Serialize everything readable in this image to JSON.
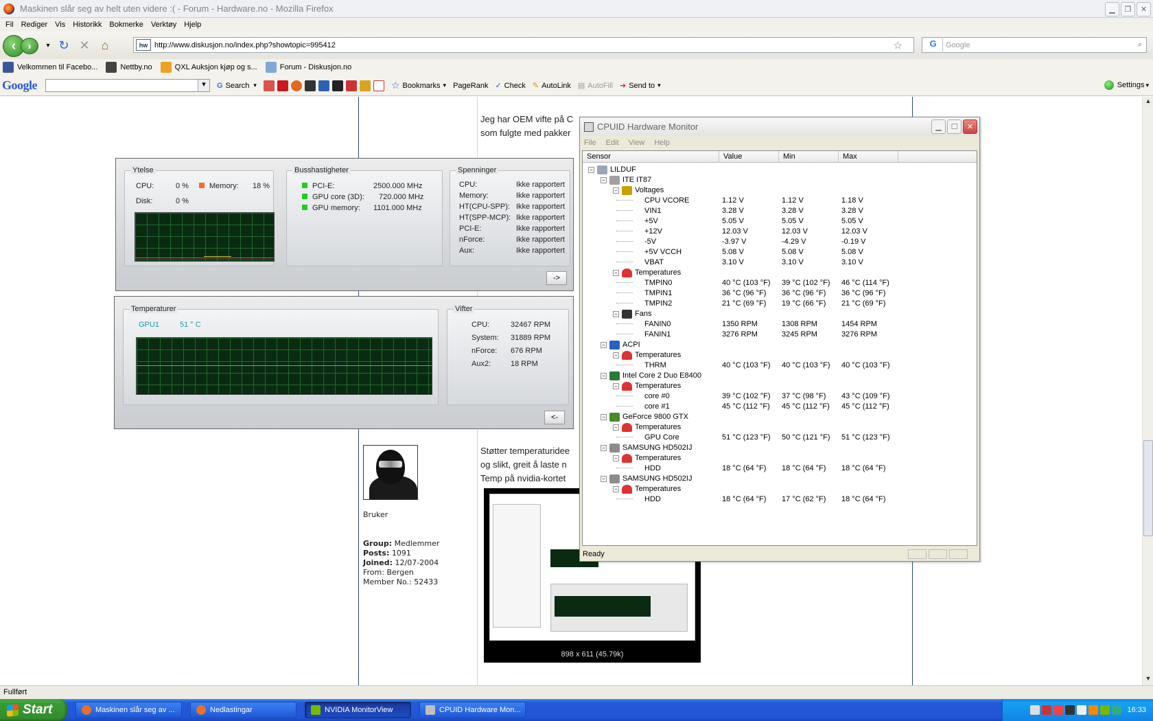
{
  "window": {
    "title": "Maskinen slår seg av helt uten videre :( - Forum - Hardware.no - Mozilla Firefox"
  },
  "menubar": [
    "Fil",
    "Rediger",
    "Vis",
    "Historikk",
    "Bokmerke",
    "Verktøy",
    "Hjelp"
  ],
  "navigation": {
    "url": "http://www.diskusjon.no/index.php?showtopic=995412",
    "favicon": "hw",
    "search_placeholder": "Google"
  },
  "bookmarks": [
    {
      "label": "Velkommen til Facebo...",
      "color": "#3b5998"
    },
    {
      "label": "Nettby.no",
      "color": "#444444"
    },
    {
      "label": "QXL Auksjon kjøp og s...",
      "color": "#f0a020"
    },
    {
      "label": "Forum - Diskusjon.no",
      "color": "#7fa8d8"
    }
  ],
  "googlebar": {
    "logo": "Google",
    "search_label": "Search",
    "bookmarks_label": "Bookmarks",
    "pagerank_label": "PageRank",
    "check_label": "Check",
    "autolink_label": "AutoLink",
    "autofill_label": "AutoFill",
    "sendto_label": "Send to",
    "settings_label": "Settings"
  },
  "forum": {
    "post_lines": [
      "Jeg har OEM vifte på C",
      "som fulgte med pakker"
    ],
    "post2_lines": [
      "Støtter temperaturidee",
      "og slikt, greit å laste n",
      "Temp på nvidia-kortet"
    ],
    "user": {
      "role": "Bruker",
      "group_label": "Group:",
      "group": "Medlemmer",
      "posts_label": "Posts:",
      "posts": "1091",
      "joined_label": "Joined:",
      "joined": "12/07-2004",
      "from_label": "From:",
      "from": "Bergen",
      "member_label": "Member No.:",
      "member_no": "52433"
    },
    "image_caption": "898 x 611 (45.79k)"
  },
  "nvidia_top": {
    "ytelse": {
      "title": "Ytelse",
      "cpu_label": "CPU:",
      "cpu_value": "0 %",
      "memory_label": "Memory:",
      "memory_value": "18 %",
      "disk_label": "Disk:",
      "disk_value": "0 %"
    },
    "buss": {
      "title": "Busshastigheter",
      "rows": [
        {
          "label": "PCI-E:",
          "value": "2500.000 MHz"
        },
        {
          "label": "GPU core (3D):",
          "value": "720.000 MHz"
        },
        {
          "label": "GPU memory:",
          "value": "1101.000 MHz"
        }
      ]
    },
    "spenninger": {
      "title": "Spenninger",
      "rows": [
        {
          "label": "CPU:",
          "value": "Ikke rapportert"
        },
        {
          "label": "Memory:",
          "value": "Ikke rapportert"
        },
        {
          "label": "HT(CPU-SPP):",
          "value": "Ikke rapportert"
        },
        {
          "label": "HT(SPP-MCP):",
          "value": "Ikke rapportert"
        },
        {
          "label": "PCI-E:",
          "value": "Ikke rapportert"
        },
        {
          "label": "nForce:",
          "value": "Ikke rapportert"
        },
        {
          "label": "Aux:",
          "value": "Ikke rapportert"
        }
      ]
    },
    "button": "->"
  },
  "nvidia_bottom": {
    "temp": {
      "title": "Temperaturer",
      "gpu_label": "GPU1",
      "gpu_value": "51 ° C"
    },
    "vifter": {
      "title": "Vifter",
      "rows": [
        {
          "label": "CPU:",
          "value": "32467 RPM"
        },
        {
          "label": "System:",
          "value": "31889 RPM"
        },
        {
          "label": "nForce:",
          "value": "676 RPM"
        },
        {
          "label": "Aux2:",
          "value": "18 RPM"
        }
      ]
    },
    "button": "<-"
  },
  "cpuid": {
    "title": "CPUID Hardware Monitor",
    "menu": [
      "File",
      "Edit",
      "View",
      "Help"
    ],
    "columns": [
      "Sensor",
      "Value",
      "Min",
      "Max"
    ],
    "rows": [
      {
        "level": 0,
        "exp": true,
        "icon": "computer-icon",
        "sensor": "LILDUF",
        "value": "",
        "min": "",
        "max": ""
      },
      {
        "level": 1,
        "exp": true,
        "icon": "chip-icon",
        "sensor": "ITE IT87",
        "value": "",
        "min": "",
        "max": ""
      },
      {
        "level": 2,
        "exp": true,
        "icon": "voltage-icon",
        "sensor": "Voltages",
        "value": "",
        "min": "",
        "max": ""
      },
      {
        "level": 3,
        "sensor": "CPU VCORE",
        "value": "1.12 V",
        "min": "1.12 V",
        "max": "1.18 V"
      },
      {
        "level": 3,
        "sensor": "VIN1",
        "value": "3.28 V",
        "min": "3.28 V",
        "max": "3.28 V"
      },
      {
        "level": 3,
        "sensor": "+5V",
        "value": "5.05 V",
        "min": "5.05 V",
        "max": "5.05 V"
      },
      {
        "level": 3,
        "sensor": "+12V",
        "value": "12.03 V",
        "min": "12.03 V",
        "max": "12.03 V"
      },
      {
        "level": 3,
        "sensor": "-5V",
        "value": "-3.97 V",
        "min": "-4.29 V",
        "max": "-0.19 V"
      },
      {
        "level": 3,
        "sensor": "+5V VCCH",
        "value": "5.08 V",
        "min": "5.08 V",
        "max": "5.08 V"
      },
      {
        "level": 3,
        "sensor": "VBAT",
        "value": "3.10 V",
        "min": "3.10 V",
        "max": "3.10 V"
      },
      {
        "level": 2,
        "exp": true,
        "icon": "thermometer-icon",
        "sensor": "Temperatures",
        "value": "",
        "min": "",
        "max": ""
      },
      {
        "level": 3,
        "sensor": "TMPIN0",
        "value": "40 °C (103 °F)",
        "min": "39 °C (102 °F)",
        "max": "46 °C (114 °F)"
      },
      {
        "level": 3,
        "sensor": "TMPIN1",
        "value": "36 °C (96 °F)",
        "min": "36 °C (96 °F)",
        "max": "36 °C (96 °F)"
      },
      {
        "level": 3,
        "sensor": "TMPIN2",
        "value": "21 °C (69 °F)",
        "min": "19 °C (66 °F)",
        "max": "21 °C (69 °F)"
      },
      {
        "level": 2,
        "exp": true,
        "icon": "fan-icon",
        "sensor": "Fans",
        "value": "",
        "min": "",
        "max": ""
      },
      {
        "level": 3,
        "sensor": "FANIN0",
        "value": "1350 RPM",
        "min": "1308 RPM",
        "max": "1454 RPM"
      },
      {
        "level": 3,
        "sensor": "FANIN1",
        "value": "3276 RPM",
        "min": "3245 RPM",
        "max": "3276 RPM"
      },
      {
        "level": 1,
        "exp": true,
        "icon": "shield-icon",
        "sensor": "ACPI",
        "value": "",
        "min": "",
        "max": ""
      },
      {
        "level": 2,
        "exp": true,
        "icon": "thermometer-icon",
        "sensor": "Temperatures",
        "value": "",
        "min": "",
        "max": ""
      },
      {
        "level": 3,
        "sensor": "THRM",
        "value": "40 °C (103 °F)",
        "min": "40 °C (103 °F)",
        "max": "40 °C (103 °F)"
      },
      {
        "level": 1,
        "exp": true,
        "icon": "cpu-icon",
        "sensor": "Intel Core 2 Duo E8400",
        "value": "",
        "min": "",
        "max": ""
      },
      {
        "level": 2,
        "exp": true,
        "icon": "thermometer-icon",
        "sensor": "Temperatures",
        "value": "",
        "min": "",
        "max": ""
      },
      {
        "level": 3,
        "sensor": "core #0",
        "value": "39 °C (102 °F)",
        "min": "37 °C (98 °F)",
        "max": "43 °C (109 °F)"
      },
      {
        "level": 3,
        "sensor": "core #1",
        "value": "45 °C (112 °F)",
        "min": "45 °C (112 °F)",
        "max": "45 °C (112 °F)"
      },
      {
        "level": 1,
        "exp": true,
        "icon": "gpu-icon",
        "sensor": "GeForce 9800 GTX",
        "value": "",
        "min": "",
        "max": ""
      },
      {
        "level": 2,
        "exp": true,
        "icon": "thermometer-icon",
        "sensor": "Temperatures",
        "value": "",
        "min": "",
        "max": ""
      },
      {
        "level": 3,
        "sensor": "GPU Core",
        "value": "51 °C (123 °F)",
        "min": "50 °C (121 °F)",
        "max": "51 °C (123 °F)"
      },
      {
        "level": 1,
        "exp": true,
        "icon": "disk-icon",
        "sensor": "SAMSUNG HD502IJ",
        "value": "",
        "min": "",
        "max": ""
      },
      {
        "level": 2,
        "exp": true,
        "icon": "thermometer-icon",
        "sensor": "Temperatures",
        "value": "",
        "min": "",
        "max": ""
      },
      {
        "level": 3,
        "sensor": "HDD",
        "value": "18 °C (64 °F)",
        "min": "18 °C (64 °F)",
        "max": "18 °C (64 °F)"
      },
      {
        "level": 1,
        "exp": true,
        "icon": "disk-icon",
        "sensor": "SAMSUNG HD502IJ",
        "value": "",
        "min": "",
        "max": ""
      },
      {
        "level": 2,
        "exp": true,
        "icon": "thermometer-icon",
        "sensor": "Temperatures",
        "value": "",
        "min": "",
        "max": ""
      },
      {
        "level": 3,
        "sensor": "HDD",
        "value": "18 °C (64 °F)",
        "min": "17 °C (62 °F)",
        "max": "18 °C (64 °F)"
      }
    ],
    "status": "Ready"
  },
  "statusbar": {
    "text": "Fullført"
  },
  "taskbar": {
    "start_label": "Start",
    "tasks": [
      {
        "label": "Maskinen slår seg av ...",
        "active": false,
        "color": "#e8702a"
      },
      {
        "label": "Nedlastingar",
        "active": false,
        "color": "#e8702a"
      },
      {
        "label": "NVIDIA MonitorView",
        "active": true,
        "color": "#76b900"
      },
      {
        "label": "CPUID Hardware Mon...",
        "active": false,
        "color": "#c0c0c0"
      }
    ],
    "clock": "16:33"
  }
}
